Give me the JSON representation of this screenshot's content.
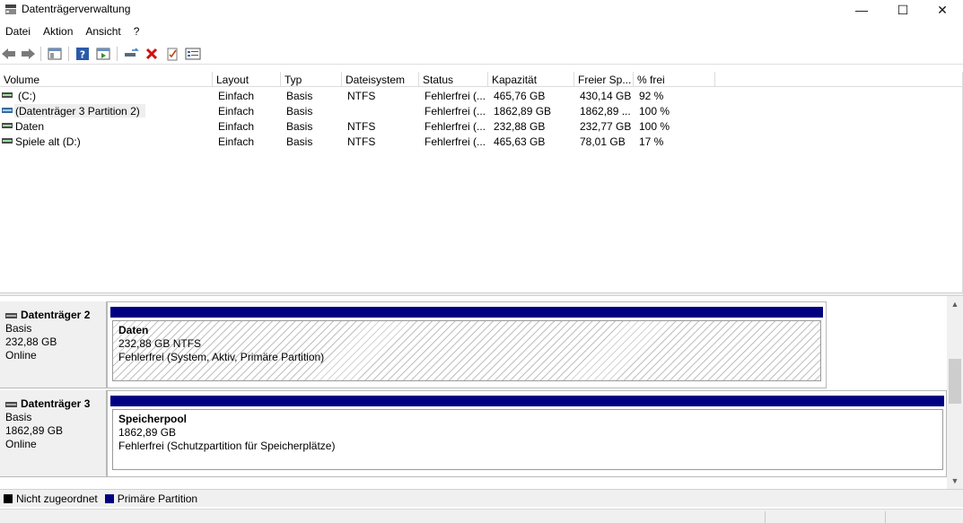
{
  "window": {
    "title": "Datenträgerverwaltung",
    "minimize_glyph": "—",
    "maximize_glyph": "☐",
    "close_glyph": "✕"
  },
  "menu": {
    "items": [
      "Datei",
      "Aktion",
      "Ansicht",
      "?"
    ]
  },
  "toolbar": {
    "icons": [
      "back-arrow-icon",
      "forward-arrow-icon",
      "console-tree-icon",
      "help-icon",
      "properties-icon",
      "connect-drive-icon",
      "delete-icon",
      "check-icon",
      "properties-list-icon"
    ]
  },
  "volume_list": {
    "columns": [
      "Volume",
      "Layout",
      "Typ",
      "Dateisystem",
      "Status",
      "Kapazität",
      "Freier Sp...",
      "% frei"
    ],
    "rows": [
      {
        "volume": "(C:)",
        "layout": "Einfach",
        "typ": "Basis",
        "dateisystem": "NTFS",
        "status": "Fehlerfrei (...",
        "kapazitaet": "465,76 GB",
        "frei": "430,14 GB",
        "prozent": "92 %"
      },
      {
        "volume": "(Datenträger 3 Partition 2)",
        "layout": "Einfach",
        "typ": "Basis",
        "dateisystem": "",
        "status": "Fehlerfrei (...",
        "kapazitaet": "1862,89 GB",
        "frei": "1862,89 ...",
        "prozent": "100 %"
      },
      {
        "volume": "Daten",
        "layout": "Einfach",
        "typ": "Basis",
        "dateisystem": "NTFS",
        "status": "Fehlerfrei (...",
        "kapazitaet": "232,88 GB",
        "frei": "232,77 GB",
        "prozent": "100 %"
      },
      {
        "volume": "Spiele alt (D:)",
        "layout": "Einfach",
        "typ": "Basis",
        "dateisystem": "NTFS",
        "status": "Fehlerfrei (...",
        "kapazitaet": "465,63 GB",
        "frei": "78,01 GB",
        "prozent": "17 %"
      }
    ]
  },
  "disks": [
    {
      "name": "Datenträger 2",
      "type": "Basis",
      "size": "232,88 GB",
      "state": "Online",
      "partition": {
        "name": "Daten",
        "size_fs": "232,88 GB NTFS",
        "status": "Fehlerfrei (System, Aktiv, Primäre Partition)"
      }
    },
    {
      "name": "Datenträger 3",
      "type": "Basis",
      "size": "1862,89 GB",
      "state": "Online",
      "partition": {
        "name": "Speicherpool",
        "size_fs": "1862,89 GB",
        "status": "Fehlerfrei (Schutzpartition für Speicherplätze)"
      }
    }
  ],
  "legend": {
    "items": [
      {
        "label": "Nicht zugeordnet",
        "color": "#000000"
      },
      {
        "label": "Primäre Partition",
        "color": "#000080"
      }
    ]
  },
  "scrollbar": {
    "up_glyph": "▲",
    "down_glyph": "▼"
  }
}
